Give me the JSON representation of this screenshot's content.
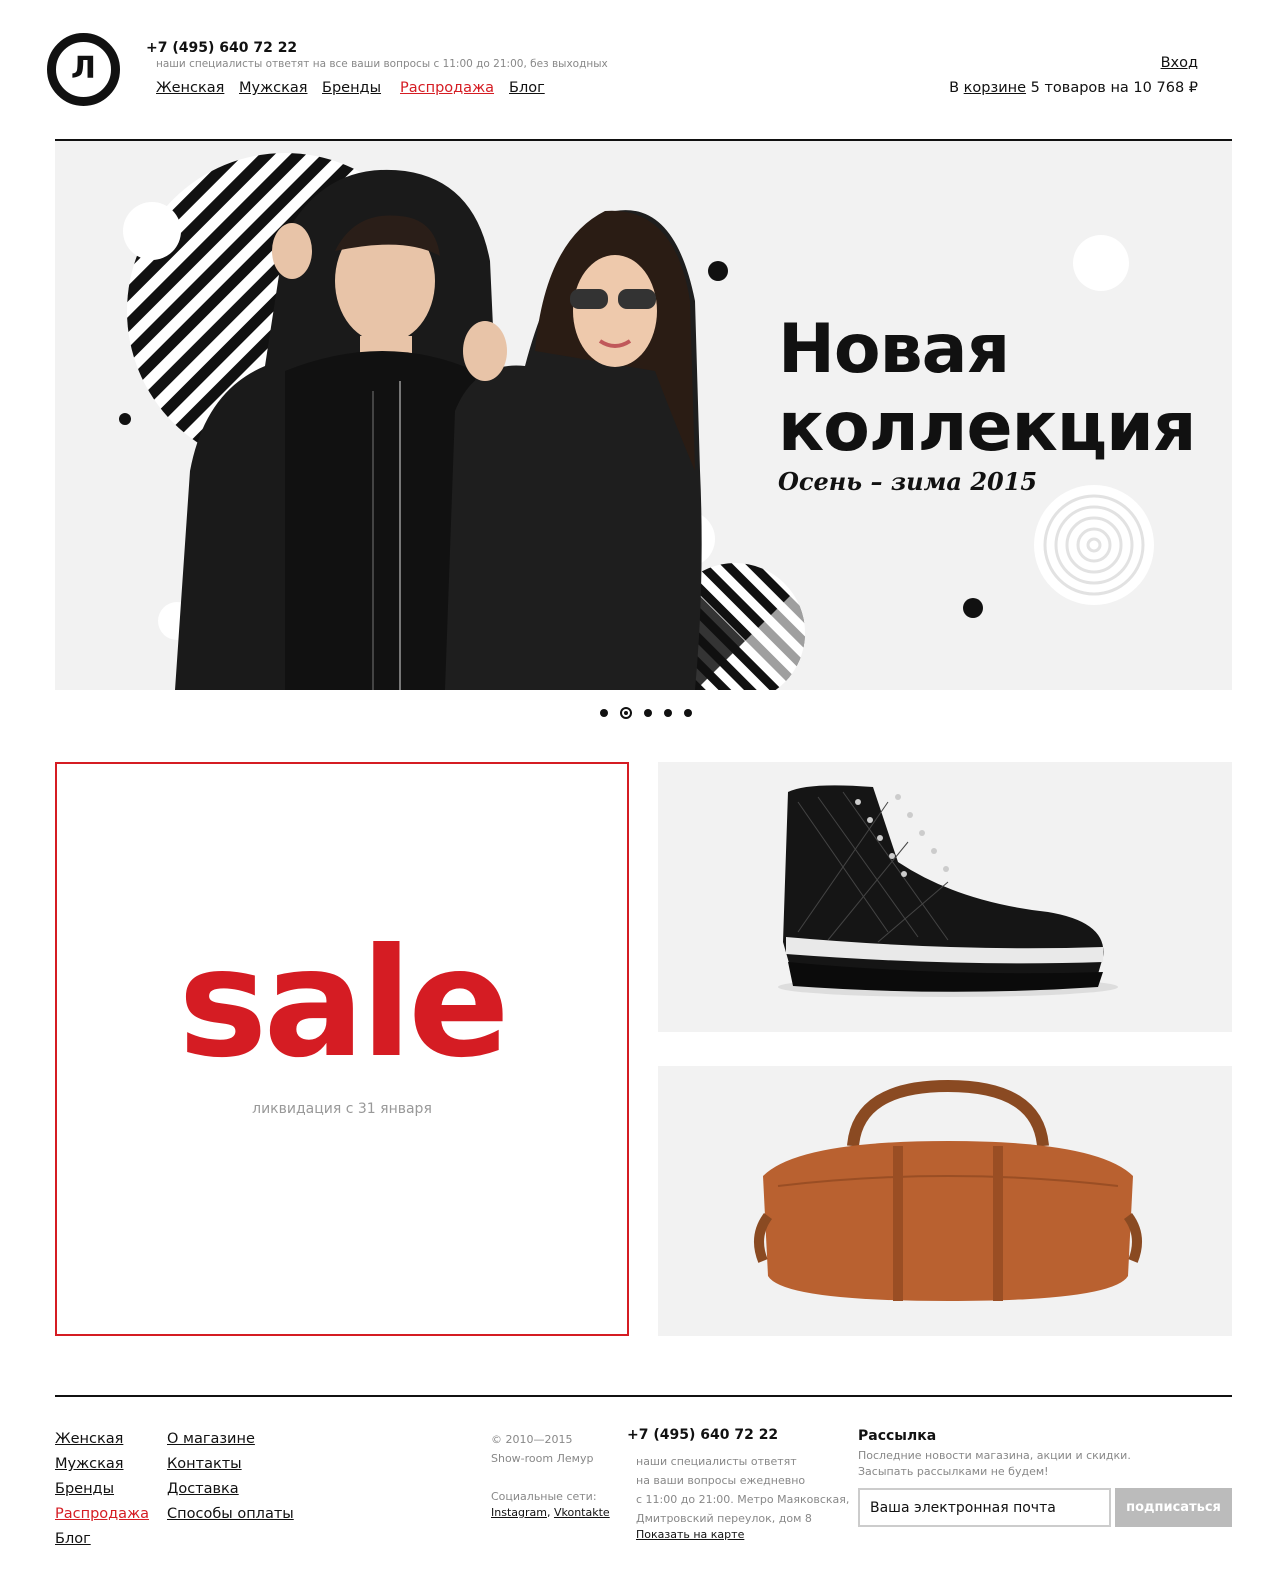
{
  "header": {
    "logo_letter": "Л",
    "phone": "+7 (495) 640 72 22",
    "phone_note": "наши специалисты ответят на все ваши вопросы с 11:00 до 21:00, без выходных",
    "nav": [
      "Женская",
      "Мужская",
      "Бренды",
      "Распродажа",
      "Блог"
    ],
    "login": "Вход",
    "cart_prefix": "В",
    "cart_link": "корзине",
    "cart_suffix": "5 товаров на 10 768 ₽"
  },
  "hero": {
    "title_line1": "Новая",
    "title_line2": "коллекция",
    "subtitle": "Осень – зима 2015",
    "slide_count": 5,
    "active_slide": 2
  },
  "promo": {
    "sale_word": "sale",
    "sale_note": "ликвидация с 31 января"
  },
  "footer": {
    "col1": [
      "Женская",
      "Мужская",
      "Бренды",
      "Распродажа",
      "Блог"
    ],
    "col2": [
      "О магазине",
      "Контакты",
      "Доставка",
      "Способы оплаты"
    ],
    "copyright": "© 2010—2015",
    "showroom": "Show-room Лемур",
    "social_label": "Социальные сети:",
    "social_instagram": "Instagram",
    "social_sep": ",",
    "social_vk": "Vkontakte",
    "phone": "+7 (495) 640 72 22",
    "info_lines": [
      "наши специалисты ответят",
      "на ваши вопросы ежедневно",
      "с 11:00 до 21:00. Метро Маяковская,",
      "Дмитровский переулок, дом 8"
    ],
    "map_link": "Показать на карте",
    "newsletter_title": "Рассылка",
    "newsletter_text1": "Последние новости магазина, акции и скидки.",
    "newsletter_text2": "Засыпать рассылками не будем!",
    "email_placeholder": "Ваша электронная почта",
    "subscribe_label": "подписаться"
  },
  "colors": {
    "accent_red": "#d51c23",
    "panel_gray": "#f2f2f2",
    "button_gray": "#bbbbbb"
  }
}
